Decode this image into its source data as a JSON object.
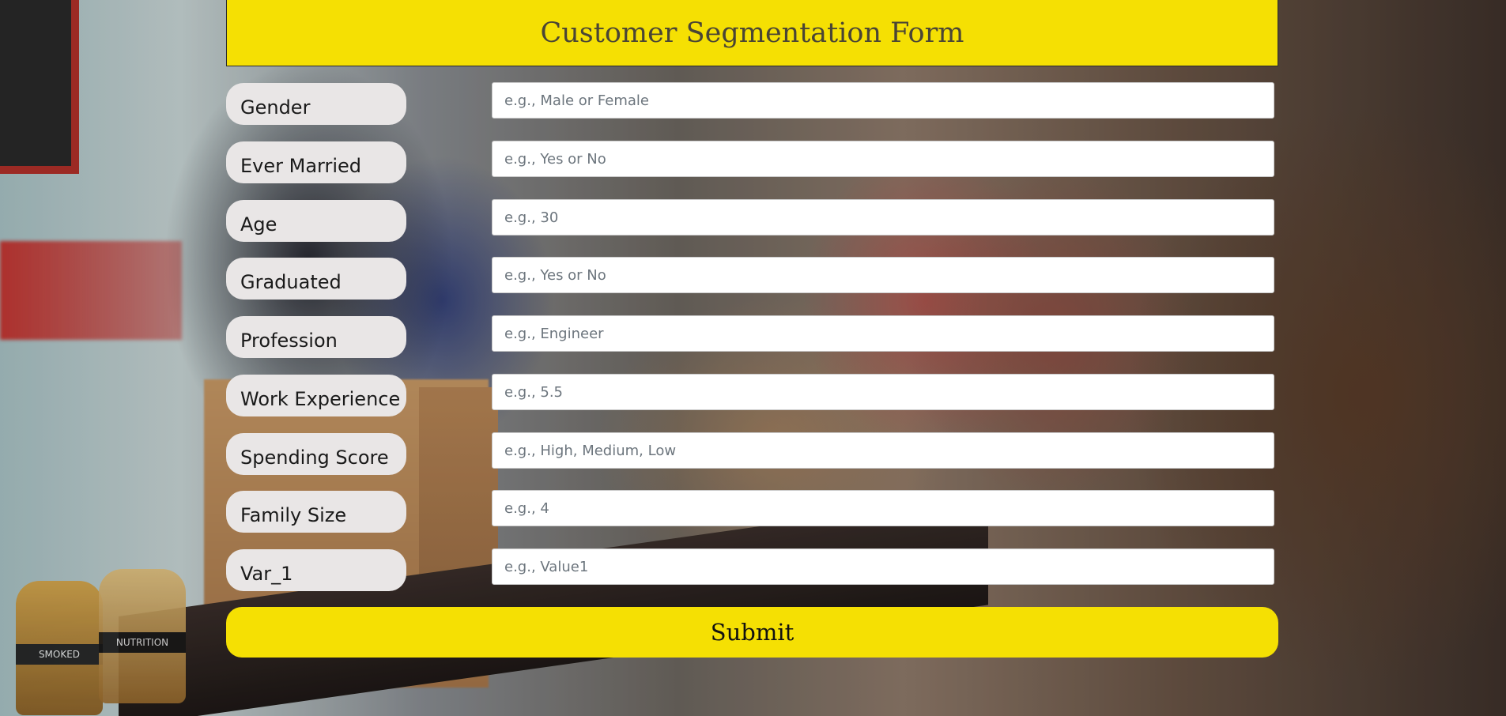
{
  "form": {
    "title": "Customer Segmentation Form",
    "fields": [
      {
        "label": "Gender",
        "placeholder": "e.g., Male or Female",
        "value": ""
      },
      {
        "label": "Ever Married",
        "placeholder": "e.g., Yes or No",
        "value": ""
      },
      {
        "label": "Age",
        "placeholder": "e.g., 30",
        "value": ""
      },
      {
        "label": "Graduated",
        "placeholder": "e.g., Yes or No",
        "value": ""
      },
      {
        "label": "Profession",
        "placeholder": "e.g., Engineer",
        "value": ""
      },
      {
        "label": "Work Experience",
        "placeholder": "e.g., 5.5",
        "value": ""
      },
      {
        "label": "Spending Score",
        "placeholder": "e.g., High, Medium, Low",
        "value": ""
      },
      {
        "label": "Family Size",
        "placeholder": "e.g., 4",
        "value": ""
      },
      {
        "label": "Var_1",
        "placeholder": "e.g., Value1",
        "value": ""
      }
    ],
    "submit_label": "Submit"
  },
  "background": {
    "jar_label": "SMOKED",
    "jar_label_2": "NUTRITION"
  },
  "colors": {
    "accent": "#f5e003",
    "label_bg": "#e9e6e6"
  }
}
